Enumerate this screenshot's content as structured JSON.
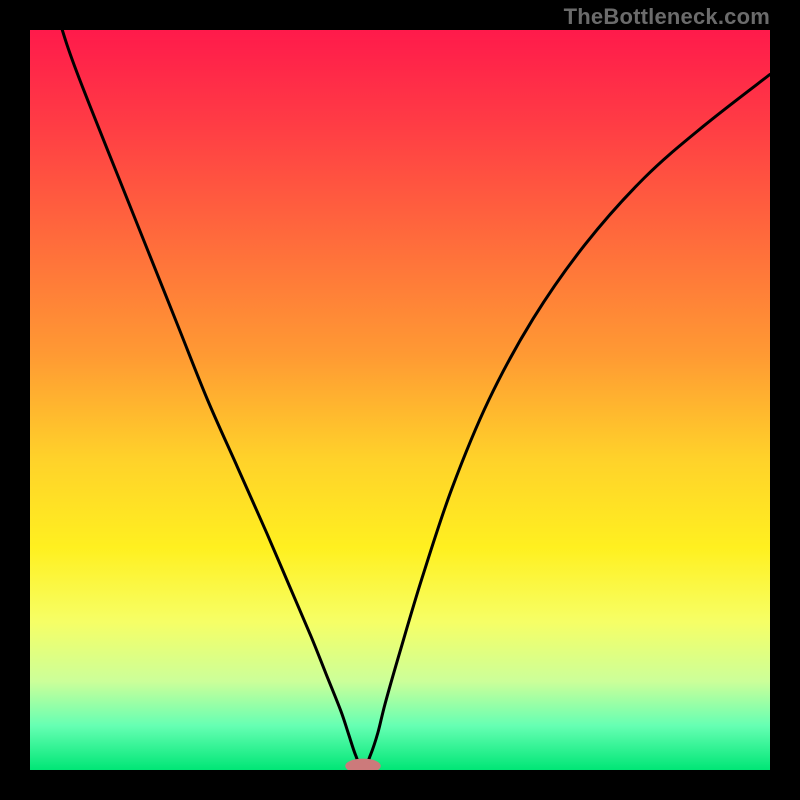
{
  "watermark": "TheBottleneck.com",
  "colors": {
    "frame": "#000000",
    "curve": "#000000",
    "marker_fill": "#cc7a7b",
    "gradient_stops": [
      {
        "offset": 0.0,
        "color": "#ff1a4b"
      },
      {
        "offset": 0.12,
        "color": "#ff3a45"
      },
      {
        "offset": 0.28,
        "color": "#ff6a3c"
      },
      {
        "offset": 0.44,
        "color": "#ff9a33"
      },
      {
        "offset": 0.58,
        "color": "#ffd22a"
      },
      {
        "offset": 0.7,
        "color": "#fff020"
      },
      {
        "offset": 0.8,
        "color": "#f6ff66"
      },
      {
        "offset": 0.88,
        "color": "#ccff99"
      },
      {
        "offset": 0.94,
        "color": "#66ffb3"
      },
      {
        "offset": 1.0,
        "color": "#00e676"
      }
    ]
  },
  "chart_data": {
    "type": "line",
    "title": "",
    "xlabel": "",
    "ylabel": "",
    "xlim": [
      0,
      100
    ],
    "ylim": [
      0,
      100
    ],
    "min_point": {
      "x": 45,
      "y": 0
    },
    "series": [
      {
        "name": "bottleneck-curve",
        "x": [
          0,
          2,
          5,
          8,
          12,
          16,
          20,
          24,
          28,
          32,
          35,
          38,
          40,
          42,
          43,
          44,
          45,
          46,
          47,
          48,
          50,
          53,
          57,
          62,
          68,
          75,
          83,
          91,
          100
        ],
        "y": [
          115,
          108,
          98,
          90,
          80,
          70,
          60,
          50,
          41,
          32,
          25,
          18,
          13,
          8,
          5,
          2,
          0,
          2,
          5,
          9,
          16,
          26,
          38,
          50,
          61,
          71,
          80,
          87,
          94
        ]
      }
    ],
    "marker": {
      "x": 45,
      "y": 0,
      "rx": 2.4,
      "ry": 1.0
    }
  }
}
